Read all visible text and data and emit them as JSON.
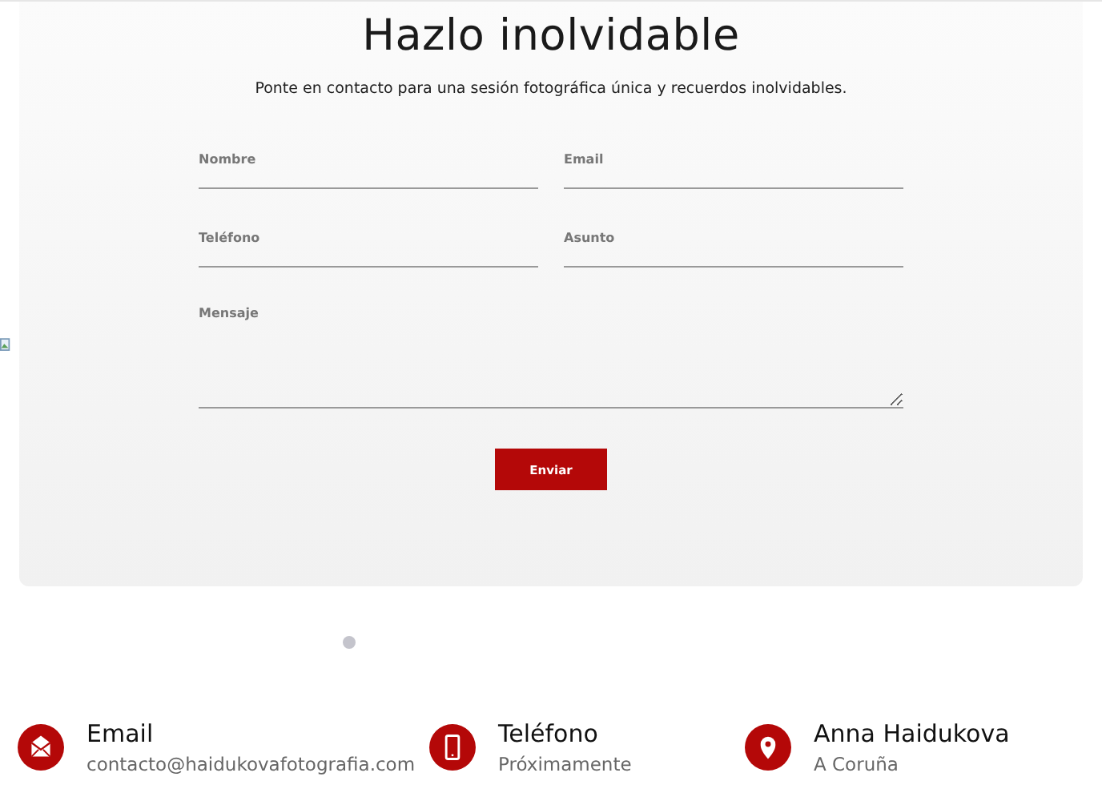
{
  "contact_form": {
    "title": "Hazlo inolvidable",
    "subtitle": "Ponte en contacto para una sesión fotográfica única y recuerdos inolvidables.",
    "fields": [
      {
        "kind": "input",
        "placeholder": "Nombre"
      },
      {
        "kind": "input",
        "placeholder": "Email"
      },
      {
        "kind": "input",
        "placeholder": "Teléfono"
      },
      {
        "kind": "input",
        "placeholder": "Asunto"
      },
      {
        "kind": "textarea",
        "placeholder": "Mensaje"
      }
    ],
    "submit": "Enviar"
  },
  "contact_info": [
    {
      "kind": "email",
      "title": "Email",
      "detail": "contacto@haidukovafotografia.com"
    },
    {
      "kind": "phone",
      "title": "Teléfono",
      "detail": "Próximamente"
    },
    {
      "kind": "location",
      "title": "Anna Haidukova",
      "detail": "A Coruña"
    }
  ]
}
